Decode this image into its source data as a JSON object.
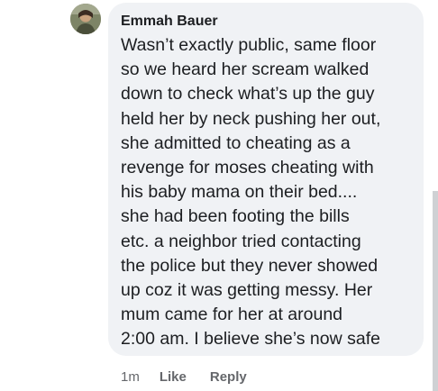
{
  "comment": {
    "author": "Emmah Bauer",
    "lines": [
      "Wasn’t exactly public, same floor",
      "so we heard her scream walked",
      "down to check what’s up the guy",
      "held her by neck pushing her out,",
      "she admitted to cheating as a",
      "revenge for moses cheating with",
      "his baby mama on their bed....",
      "she had been footing the bills",
      "etc. a neighbor tried contacting",
      "the police but they never showed",
      "up coz it was getting messy. Her",
      "mum came for her at around",
      "2:00 am. I believe she’s now safe"
    ],
    "time": "1m",
    "like_label": "Like",
    "reply_label": "Reply"
  },
  "colors": {
    "bubble_bg": "#f0f2f5",
    "text": "#1c1e21",
    "meta_text": "#65676b"
  }
}
